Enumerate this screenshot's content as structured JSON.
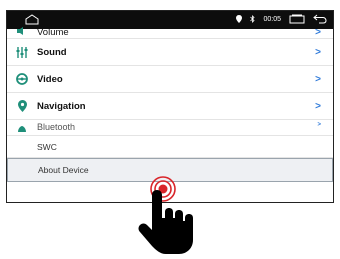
{
  "statusbar": {
    "time": "00:05"
  },
  "menu": {
    "items": [
      {
        "label": "Volume",
        "icon": "speaker-icon"
      },
      {
        "label": "Sound",
        "icon": "equalizer-icon"
      },
      {
        "label": "Video",
        "icon": "steering-wheel-icon"
      },
      {
        "label": "Navigation",
        "icon": "location-pin-icon"
      },
      {
        "label": "Bluetooth",
        "icon": "bluetooth-icon"
      }
    ],
    "chevron": ">",
    "swc_label": "SWC",
    "about_label": "About Device"
  },
  "colors": {
    "icon_green": "#1f8f7a",
    "chevron": "#2f7ad9",
    "tap_red": "#d9252a"
  }
}
